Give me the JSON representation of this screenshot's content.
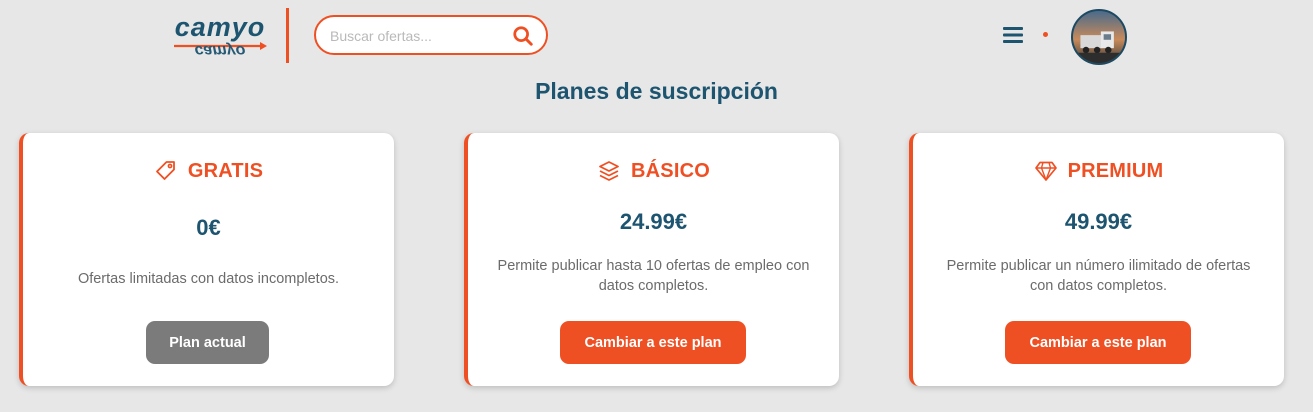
{
  "header": {
    "logo_text": "camyo",
    "search": {
      "placeholder": "Buscar ofertas...",
      "value": ""
    },
    "icons": {
      "search": "search-icon",
      "menu": "hamburger-menu-icon",
      "avatar": "user-avatar"
    }
  },
  "page": {
    "title": "Planes de suscripción"
  },
  "plans": [
    {
      "name": "GRATIS",
      "icon": "tag-icon",
      "price": "0€",
      "description": "Ofertas limitadas con datos incompletos.",
      "button_label": "Plan actual",
      "current": true
    },
    {
      "name": "BÁSICO",
      "icon": "layers-icon",
      "price": "24.99€",
      "description": "Permite publicar hasta 10 ofertas de empleo con datos completos.",
      "button_label": "Cambiar a este plan",
      "current": false
    },
    {
      "name": "PREMIUM",
      "icon": "diamond-icon",
      "price": "49.99€",
      "description": "Permite publicar un número ilimitado de ofertas con datos completos.",
      "button_label": "Cambiar a este plan",
      "current": false
    }
  ],
  "colors": {
    "accent": "#ef5023",
    "primary": "#1d5470",
    "background": "#e6e7e6",
    "current_button": "#7b7b7b"
  }
}
